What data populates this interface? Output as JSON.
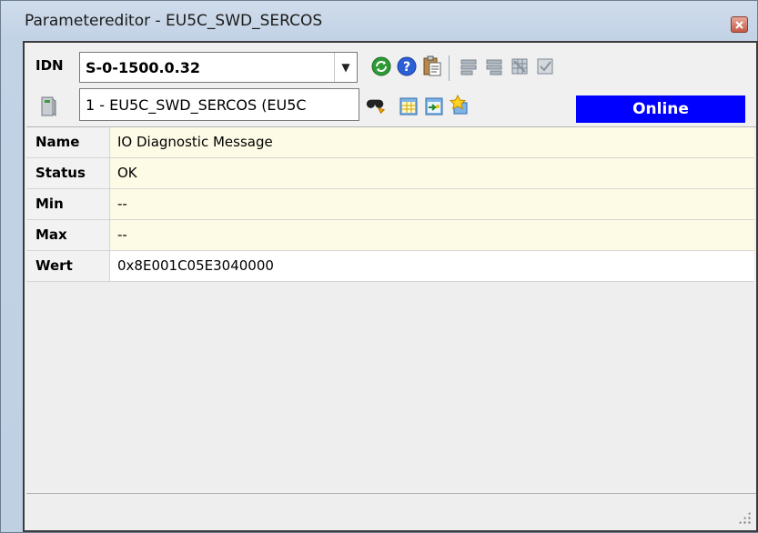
{
  "window": {
    "title": "Parametereditor - EU5C_SWD_SERCOS"
  },
  "toolbar1": {
    "idn_label": "IDN",
    "idn_value": "S-0-1500.0.32",
    "icons": [
      "refresh-icon",
      "help-icon",
      "paste-icon",
      "list-icon-1",
      "list-icon-2",
      "grid-icon",
      "check-icon"
    ]
  },
  "toolbar2": {
    "device_value": "1 - EU5C_SWD_SERCOS (EU5C",
    "icons": [
      "device-icon",
      "find-icon",
      "table-icon",
      "import-icon",
      "star-icon"
    ],
    "status": "Online"
  },
  "rows": [
    {
      "label": "Name",
      "value": "IO Diagnostic Message"
    },
    {
      "label": "Status",
      "value": "OK"
    },
    {
      "label": "Min",
      "value": "--"
    },
    {
      "label": "Max",
      "value": "--"
    },
    {
      "label": "Wert",
      "value": "0x8E001C05E3040000"
    }
  ],
  "colors": {
    "online_bg": "#0000ff",
    "readonly_bg": "#fdfbe6",
    "editable_bg": "#ffffff"
  }
}
